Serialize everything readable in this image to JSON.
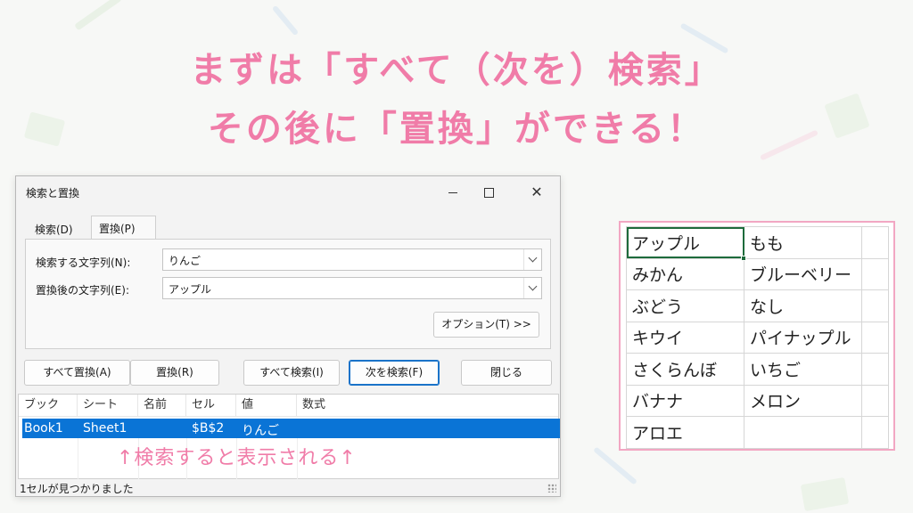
{
  "heading": {
    "line1": "まずは「すべて（次を）検索」",
    "line2": "その後に「置換」ができる！"
  },
  "dialog": {
    "title": "検索と置換",
    "tabs": [
      "検索(D)",
      "置換(P)"
    ],
    "find_label": "検索する文字列(N):",
    "find_value": "りんご",
    "replace_label": "置換後の文字列(E):",
    "replace_value": "アップル",
    "options_label": "オプション(T) >>",
    "buttons": {
      "replace_all": "すべて置換(A)",
      "replace": "置換(R)",
      "find_all": "すべて検索(I)",
      "find_next": "次を検索(F)",
      "close": "閉じる"
    },
    "results": {
      "columns": [
        "ブック",
        "シート",
        "名前",
        "セル",
        "値",
        "数式"
      ],
      "row": [
        "Book1",
        "Sheet1",
        "",
        "$B$2",
        "りんご",
        ""
      ]
    },
    "note": "↑検索すると表示される↑",
    "status": "1セルが見つかりました",
    "accent_color": "#0a74d6"
  },
  "sheet": {
    "rows": [
      [
        "アップル",
        "もも"
      ],
      [
        "みかん",
        "ブルーベリー"
      ],
      [
        "ぶどう",
        "なし"
      ],
      [
        "キウイ",
        "パイナップル"
      ],
      [
        "さくらんぼ",
        "いちご"
      ],
      [
        "バナナ",
        "メロン"
      ],
      [
        "アロエ",
        ""
      ]
    ],
    "active_cell": "A1",
    "border_color": "#f2a7c3"
  },
  "colors": {
    "heading": "#f07ca8",
    "note": "#f07ca8"
  }
}
